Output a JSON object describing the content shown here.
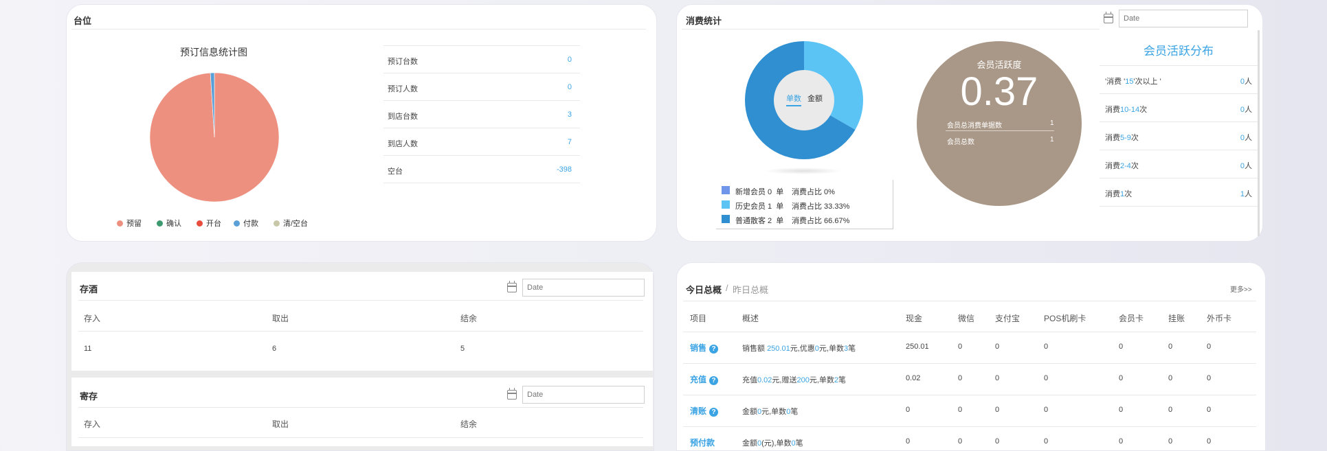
{
  "colors": {
    "reserve": "#ee9080",
    "confirm": "#3d9970",
    "open": "#e74c3c",
    "pay": "#5aa0d8",
    "clear": "#c8c8a8",
    "donut_dark": "#2f8fd0",
    "donut_light": "#5bc4f5",
    "member_circle": "#a99887",
    "accent": "#3aa3e3"
  },
  "table_card": {
    "title": "台位",
    "chart_title": "预订信息统计图",
    "legend": [
      {
        "label": "预留",
        "color_key": "reserve"
      },
      {
        "label": "确认",
        "color_key": "confirm"
      },
      {
        "label": "开台",
        "color_key": "open"
      },
      {
        "label": "付款",
        "color_key": "pay"
      },
      {
        "label": "清/空台",
        "color_key": "clear"
      }
    ],
    "stats": [
      {
        "label": "预订台数",
        "value": "0"
      },
      {
        "label": "预订人数",
        "value": "0"
      },
      {
        "label": "到店台数",
        "value": "3"
      },
      {
        "label": "到店人数",
        "value": "7"
      },
      {
        "label": "空台",
        "value": "-398"
      }
    ]
  },
  "chart_data": {
    "type": "pie",
    "categories": [
      "预留",
      "确认",
      "开台",
      "付款",
      "清/空台"
    ],
    "values": [
      99,
      0,
      0,
      1,
      0
    ]
  },
  "consume_card": {
    "title": "消费统计",
    "date_placeholder": "Date",
    "donut_tab_active": "单数",
    "donut_tab_other": "金额",
    "donut_values": [
      33.33,
      66.67
    ],
    "legend": [
      {
        "label": "新增会员 0  单",
        "ratio": "消费占比 0%",
        "color": "#6f95e8"
      },
      {
        "label": "历史会员 1  单",
        "ratio": "消费占比 33.33%",
        "color": "#5bc4f5"
      },
      {
        "label": "普通散客 2  单",
        "ratio": "消费占比 66.67%",
        "color": "#2f8fd0"
      }
    ],
    "activity_title": "会员活跃度",
    "activity_value": "0.37",
    "activity_rows": [
      {
        "label": "会员总消费单据数",
        "value": "1"
      },
      {
        "label": "会员总数",
        "value": "1"
      }
    ],
    "dist_title": "会员活跃分布",
    "dist_rows": [
      {
        "pre": "'消费 '",
        "num": "15",
        "post": "'次以上 '",
        "value": "0",
        "unit": "人"
      },
      {
        "pre": "消费",
        "num": "10-14",
        "post": "次",
        "value": "0",
        "unit": "人"
      },
      {
        "pre": "消费",
        "num": "5-9",
        "post": "次",
        "value": "0",
        "unit": "人"
      },
      {
        "pre": "消费",
        "num": "2-4",
        "post": "次",
        "value": "0",
        "unit": "人"
      },
      {
        "pre": "消费",
        "num": "1",
        "post": "次",
        "value": "1",
        "unit": "人"
      }
    ]
  },
  "wine_card": {
    "title": "存酒",
    "date_placeholder": "Date",
    "headers": [
      "存入",
      "取出",
      "结余"
    ],
    "row": [
      "11",
      "6",
      "5"
    ]
  },
  "deposit_card": {
    "title": "寄存",
    "date_placeholder": "Date",
    "headers": [
      "存入",
      "取出",
      "结余"
    ]
  },
  "summary_card": {
    "title_active": "今日总概",
    "separator": "/",
    "title_other": "昨日总概",
    "more": "更多>>",
    "headers": [
      "项目",
      "概述",
      "现金",
      "微信",
      "支付宝",
      "POS机刷卡",
      "会员卡",
      "挂账",
      "外币卡"
    ],
    "rows": [
      {
        "name": "销售",
        "desc": [
          [
            "销售额 ",
            "n"
          ],
          [
            "250.01",
            "b"
          ],
          [
            "元,优惠",
            "n"
          ],
          [
            "0",
            "b"
          ],
          [
            "元,单数",
            "n"
          ],
          [
            "3",
            "b"
          ],
          [
            "笔",
            "n"
          ]
        ],
        "vals": [
          "250.01",
          "0",
          "0",
          "0",
          "0",
          "0",
          "0"
        ]
      },
      {
        "name": "充值",
        "desc": [
          [
            "充值",
            "n"
          ],
          [
            "0.02",
            "b"
          ],
          [
            "元,赠送",
            "n"
          ],
          [
            "200",
            "b"
          ],
          [
            "元,单数",
            "n"
          ],
          [
            "2",
            "b"
          ],
          [
            "笔",
            "n"
          ]
        ],
        "vals": [
          "0.02",
          "0",
          "0",
          "0",
          "0",
          "0",
          "0"
        ]
      },
      {
        "name": "清账",
        "desc": [
          [
            "金额",
            "n"
          ],
          [
            "0",
            "b"
          ],
          [
            "元,单数",
            "n"
          ],
          [
            "0",
            "b"
          ],
          [
            "笔",
            "n"
          ]
        ],
        "vals": [
          "0",
          "0",
          "0",
          "0",
          "0",
          "0",
          "0"
        ]
      },
      {
        "name": "预付款",
        "desc": [
          [
            "金额",
            "n"
          ],
          [
            "0",
            "b"
          ],
          [
            "(元),单数",
            "n"
          ],
          [
            "0",
            "b"
          ],
          [
            "笔",
            "n"
          ]
        ],
        "vals": [
          "0",
          "0",
          "0",
          "0",
          "0",
          "0",
          "0"
        ]
      }
    ]
  }
}
